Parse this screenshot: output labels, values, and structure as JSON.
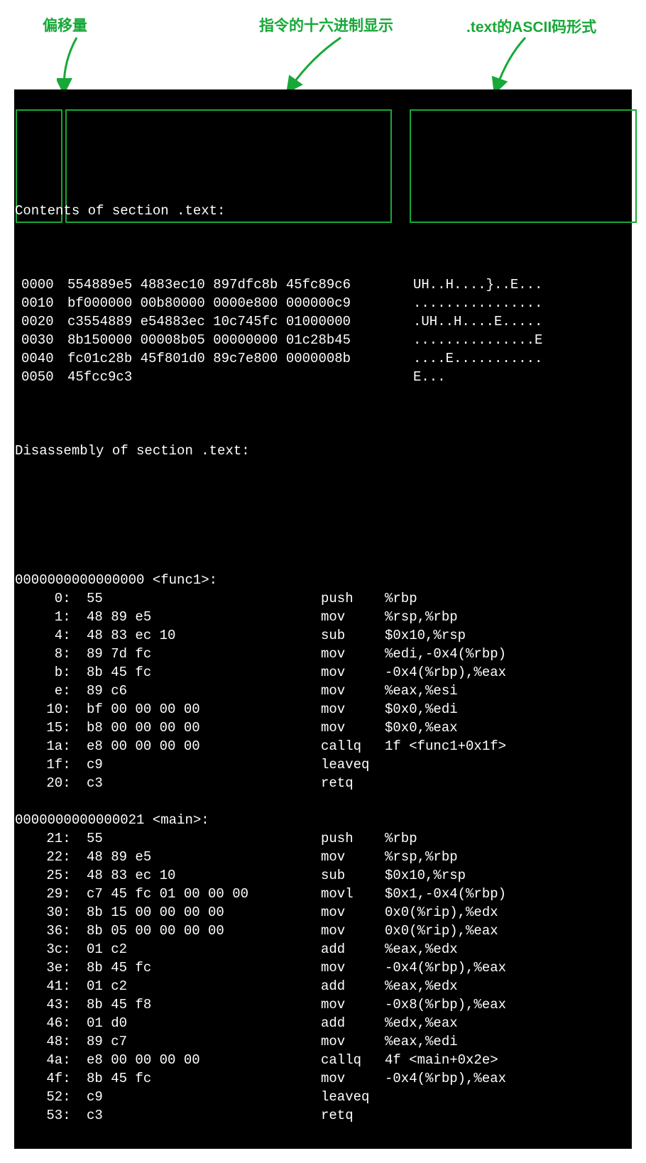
{
  "labels": {
    "offset": "偏移量",
    "hex": "指令的十六进制显示",
    "ascii": ".text的ASCII码形式"
  },
  "section_header": "Contents of section .text:",
  "hexdump": [
    {
      "offset": "0000",
      "hex": "554889e5 4883ec10 897dfc8b 45fc89c6",
      "ascii": "UH..H....}..E..."
    },
    {
      "offset": "0010",
      "hex": "bf000000 00b80000 0000e800 000000c9",
      "ascii": "................"
    },
    {
      "offset": "0020",
      "hex": "c3554889 e54883ec 10c745fc 01000000",
      "ascii": ".UH..H....E....."
    },
    {
      "offset": "0030",
      "hex": "8b150000 00008b05 00000000 01c28b45",
      "ascii": "...............E"
    },
    {
      "offset": "0040",
      "hex": "fc01c28b 45f801d0 89c7e800 0000008b",
      "ascii": "....E..........."
    },
    {
      "offset": "0050",
      "hex": "45fcc9c3",
      "ascii": "E..."
    }
  ],
  "disasm_header": "Disassembly of section .text:",
  "functions": [
    {
      "header": "0000000000000000 <func1>:",
      "rows": [
        {
          "addr": "0:",
          "bytes": "55",
          "mnem": "push",
          "ops": "%rbp"
        },
        {
          "addr": "1:",
          "bytes": "48 89 e5",
          "mnem": "mov",
          "ops": "%rsp,%rbp"
        },
        {
          "addr": "4:",
          "bytes": "48 83 ec 10",
          "mnem": "sub",
          "ops": "$0x10,%rsp"
        },
        {
          "addr": "8:",
          "bytes": "89 7d fc",
          "mnem": "mov",
          "ops": "%edi,-0x4(%rbp)"
        },
        {
          "addr": "b:",
          "bytes": "8b 45 fc",
          "mnem": "mov",
          "ops": "-0x4(%rbp),%eax"
        },
        {
          "addr": "e:",
          "bytes": "89 c6",
          "mnem": "mov",
          "ops": "%eax,%esi"
        },
        {
          "addr": "10:",
          "bytes": "bf 00 00 00 00",
          "mnem": "mov",
          "ops": "$0x0,%edi"
        },
        {
          "addr": "15:",
          "bytes": "b8 00 00 00 00",
          "mnem": "mov",
          "ops": "$0x0,%eax"
        },
        {
          "addr": "1a:",
          "bytes": "e8 00 00 00 00",
          "mnem": "callq",
          "ops": "1f <func1+0x1f>"
        },
        {
          "addr": "1f:",
          "bytes": "c9",
          "mnem": "leaveq",
          "ops": ""
        },
        {
          "addr": "20:",
          "bytes": "c3",
          "mnem": "retq",
          "ops": ""
        }
      ]
    },
    {
      "header": "0000000000000021 <main>:",
      "rows": [
        {
          "addr": "21:",
          "bytes": "55",
          "mnem": "push",
          "ops": "%rbp"
        },
        {
          "addr": "22:",
          "bytes": "48 89 e5",
          "mnem": "mov",
          "ops": "%rsp,%rbp"
        },
        {
          "addr": "25:",
          "bytes": "48 83 ec 10",
          "mnem": "sub",
          "ops": "$0x10,%rsp"
        },
        {
          "addr": "29:",
          "bytes": "c7 45 fc 01 00 00 00",
          "mnem": "movl",
          "ops": "$0x1,-0x4(%rbp)"
        },
        {
          "addr": "30:",
          "bytes": "8b 15 00 00 00 00",
          "mnem": "mov",
          "ops": "0x0(%rip),%edx"
        },
        {
          "addr": "36:",
          "bytes": "8b 05 00 00 00 00",
          "mnem": "mov",
          "ops": "0x0(%rip),%eax"
        },
        {
          "addr": "3c:",
          "bytes": "01 c2",
          "mnem": "add",
          "ops": "%eax,%edx"
        },
        {
          "addr": "3e:",
          "bytes": "8b 45 fc",
          "mnem": "mov",
          "ops": "-0x4(%rbp),%eax"
        },
        {
          "addr": "41:",
          "bytes": "01 c2",
          "mnem": "add",
          "ops": "%eax,%edx"
        },
        {
          "addr": "43:",
          "bytes": "8b 45 f8",
          "mnem": "mov",
          "ops": "-0x8(%rbp),%eax"
        },
        {
          "addr": "46:",
          "bytes": "01 d0",
          "mnem": "add",
          "ops": "%edx,%eax"
        },
        {
          "addr": "48:",
          "bytes": "89 c7",
          "mnem": "mov",
          "ops": "%eax,%edi"
        },
        {
          "addr": "4a:",
          "bytes": "e8 00 00 00 00",
          "mnem": "callq",
          "ops": "4f <main+0x2e>"
        },
        {
          "addr": "4f:",
          "bytes": "8b 45 fc",
          "mnem": "mov",
          "ops": "-0x4(%rbp),%eax"
        },
        {
          "addr": "52:",
          "bytes": "c9",
          "mnem": "leaveq",
          "ops": ""
        },
        {
          "addr": "53:",
          "bytes": "c3",
          "mnem": "retq",
          "ops": ""
        }
      ]
    }
  ]
}
